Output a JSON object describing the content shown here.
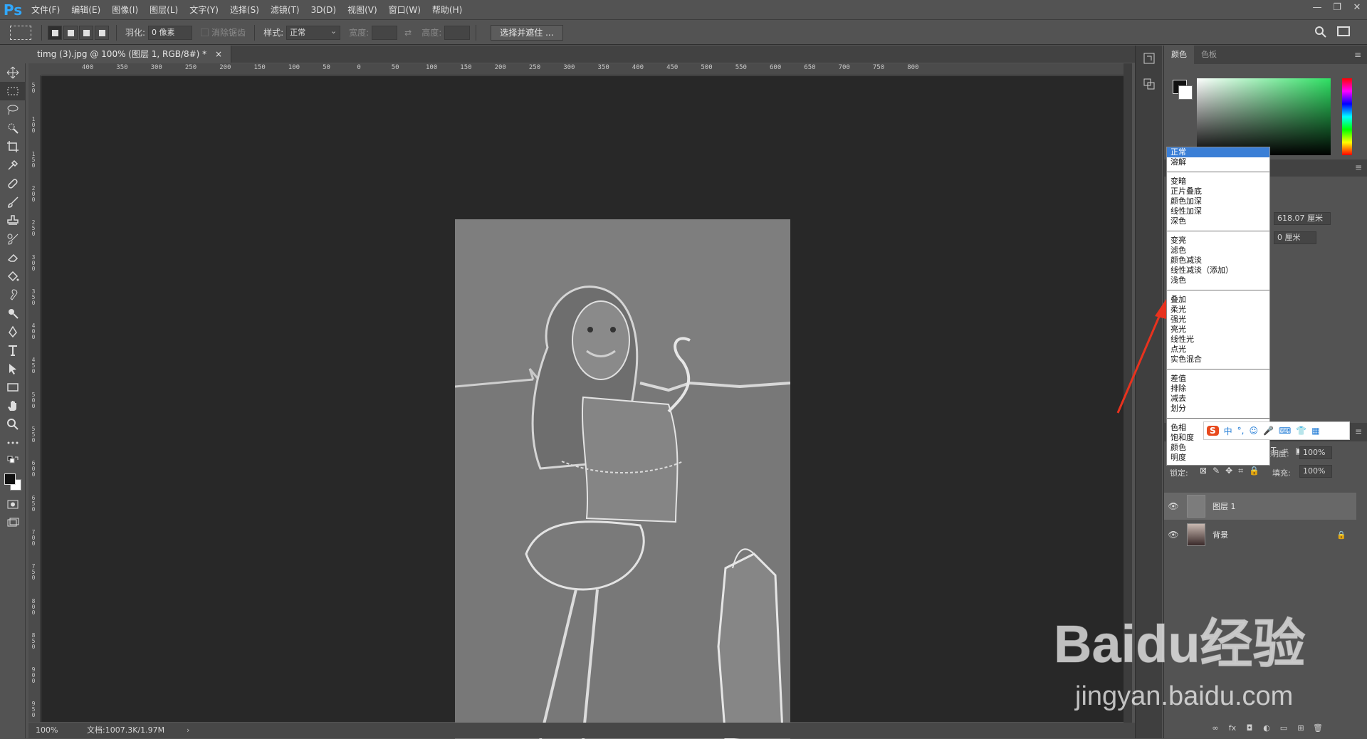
{
  "app": {
    "logo": "Ps"
  },
  "menu": [
    "文件(F)",
    "编辑(E)",
    "图像(I)",
    "图层(L)",
    "文字(Y)",
    "选择(S)",
    "滤镜(T)",
    "3D(D)",
    "视图(V)",
    "窗口(W)",
    "帮助(H)"
  ],
  "window_controls": [
    "—",
    "❐",
    "✕"
  ],
  "options": {
    "feather_label": "羽化:",
    "feather_value": "0 像素",
    "antialias_label": "消除锯齿",
    "style_label": "样式:",
    "style_value": "正常",
    "width_label": "宽度:",
    "height_label": "高度:",
    "select_mask_button": "选择并遮住 ..."
  },
  "document": {
    "tab_title": "timg (3).jpg @ 100% (图层 1, RGB/8#) *",
    "tab_close": "×",
    "zoom": "100%",
    "doc_info": "文档:1007.3K/1.97M",
    "status_arrow": "›"
  },
  "ruler": {
    "h_labels": [
      "400",
      "350",
      "300",
      "250",
      "200",
      "150",
      "100",
      "50",
      "0",
      "50",
      "100",
      "150",
      "200",
      "250",
      "300",
      "350",
      "400",
      "450",
      "500",
      "550",
      "600",
      "650",
      "700",
      "750",
      "800"
    ],
    "v_labels": [
      "5 0",
      "1 0 0",
      "1 5 0",
      "2 0 0",
      "2 5 0",
      "3 0 0",
      "3 5 0",
      "4 0 0",
      "4 5 0",
      "5 0 0",
      "5 5 0",
      "6 0 0",
      "6 5 0",
      "7 0 0",
      "7 5 0",
      "8 0 0",
      "8 5 0",
      "9 0 0",
      "9 5 0"
    ]
  },
  "right_panel": {
    "tabs": [
      "颜色",
      "色板"
    ],
    "prop_value_1": "618.07 厘米",
    "prop_value_2": "0 厘米",
    "blend_mode": "正常",
    "opacity_label": "不透明度:",
    "opacity_value": "100%",
    "lock_label": "锁定:",
    "fill_label": "填充:",
    "fill_value": "100%",
    "layers": [
      {
        "name": "图层 1",
        "selected": true
      },
      {
        "name": "背景",
        "selected": false
      }
    ]
  },
  "blend_dropdown": {
    "groups": [
      [
        "正常",
        "溶解"
      ],
      [
        "变暗",
        "正片叠底",
        "颜色加深",
        "线性加深",
        "深色"
      ],
      [
        "变亮",
        "滤色",
        "颜色减淡",
        "线性减淡（添加）",
        "浅色"
      ],
      [
        "叠加",
        "柔光",
        "强光",
        "亮光",
        "线性光",
        "点光",
        "实色混合"
      ],
      [
        "差值",
        "排除",
        "减去",
        "划分"
      ],
      [
        "色相",
        "饱和度",
        "颜色",
        "明度"
      ]
    ],
    "highlighted": "正常"
  },
  "ime_bar": {
    "items": [
      "S",
      "中",
      "°,",
      "☺",
      "🎤",
      "⌨",
      "👕",
      "▦"
    ]
  },
  "watermark": {
    "brand": "Baidu经验",
    "url": "jingyan.baidu.com"
  },
  "colors": {
    "accent": "#31a8ff",
    "highlight": "#3b7fd6",
    "arrow": "#e8321e"
  }
}
